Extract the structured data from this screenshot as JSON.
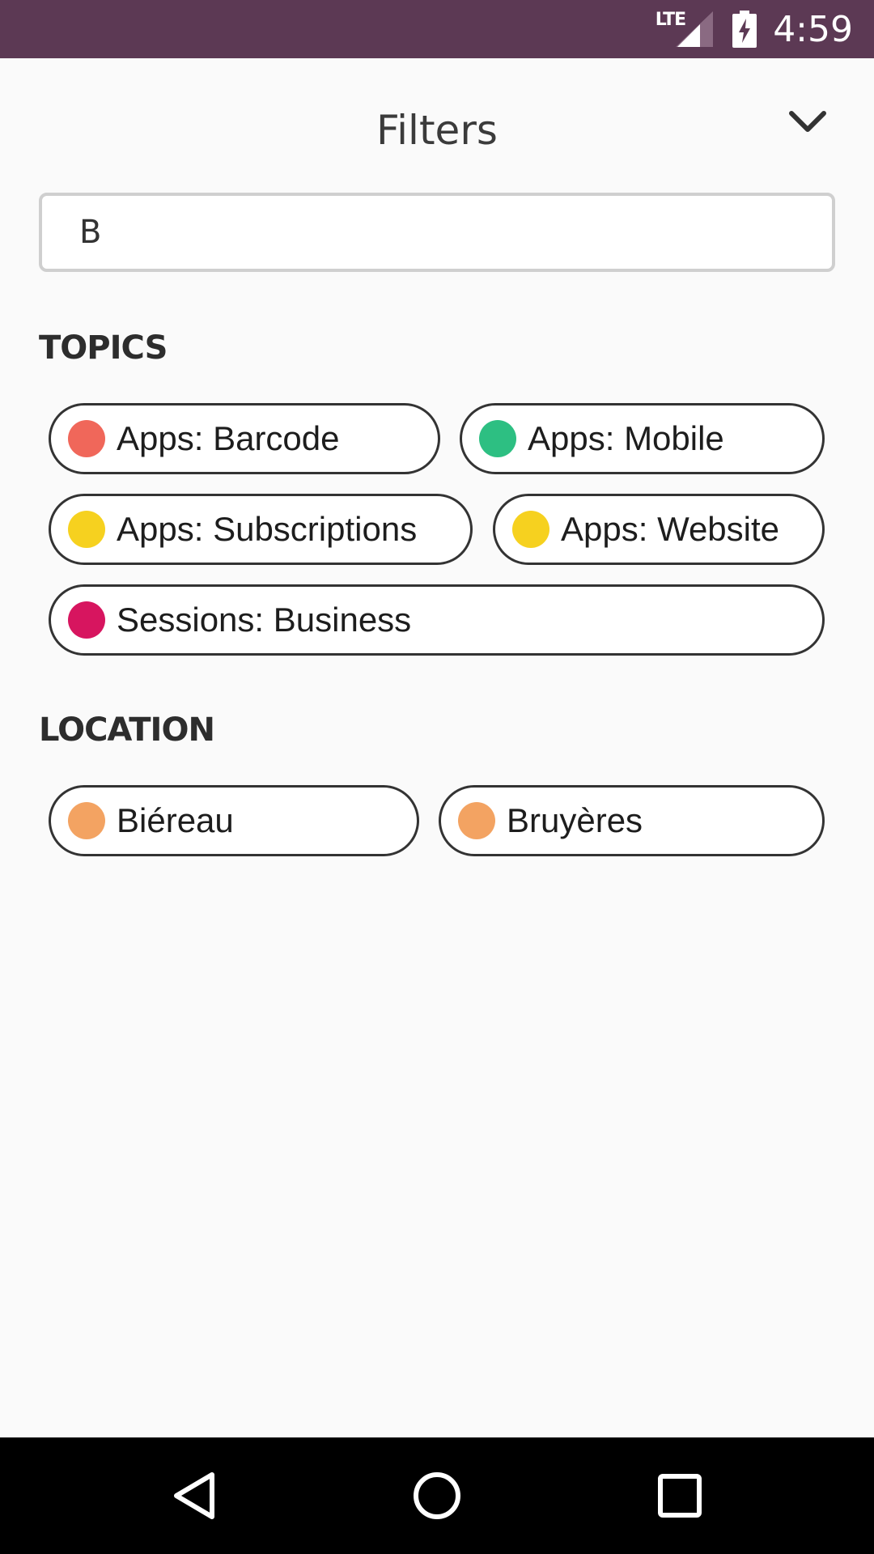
{
  "status_bar": {
    "network": "LTE",
    "time": "4:59"
  },
  "header": {
    "title": "Filters"
  },
  "search": {
    "value": "B"
  },
  "topics": {
    "title": "TOPICS",
    "chips": [
      {
        "label": "Apps: Barcode",
        "color": "#f0675a"
      },
      {
        "label": "Apps: Mobile",
        "color": "#2dbf82"
      },
      {
        "label": "Apps: Subscriptions",
        "color": "#f6d11f"
      },
      {
        "label": "Apps: Website",
        "color": "#f6d11f"
      },
      {
        "label": "Sessions: Business",
        "color": "#d7155f"
      }
    ]
  },
  "location": {
    "title": "LOCATION",
    "chips": [
      {
        "label": "Biéreau",
        "color": "#f3a362"
      },
      {
        "label": "Bruyères",
        "color": "#f3a362"
      }
    ]
  },
  "icons": {
    "collapse": "chevron-down-icon",
    "back": "back-triangle-icon",
    "home": "home-circle-icon",
    "recents": "recents-square-icon"
  }
}
